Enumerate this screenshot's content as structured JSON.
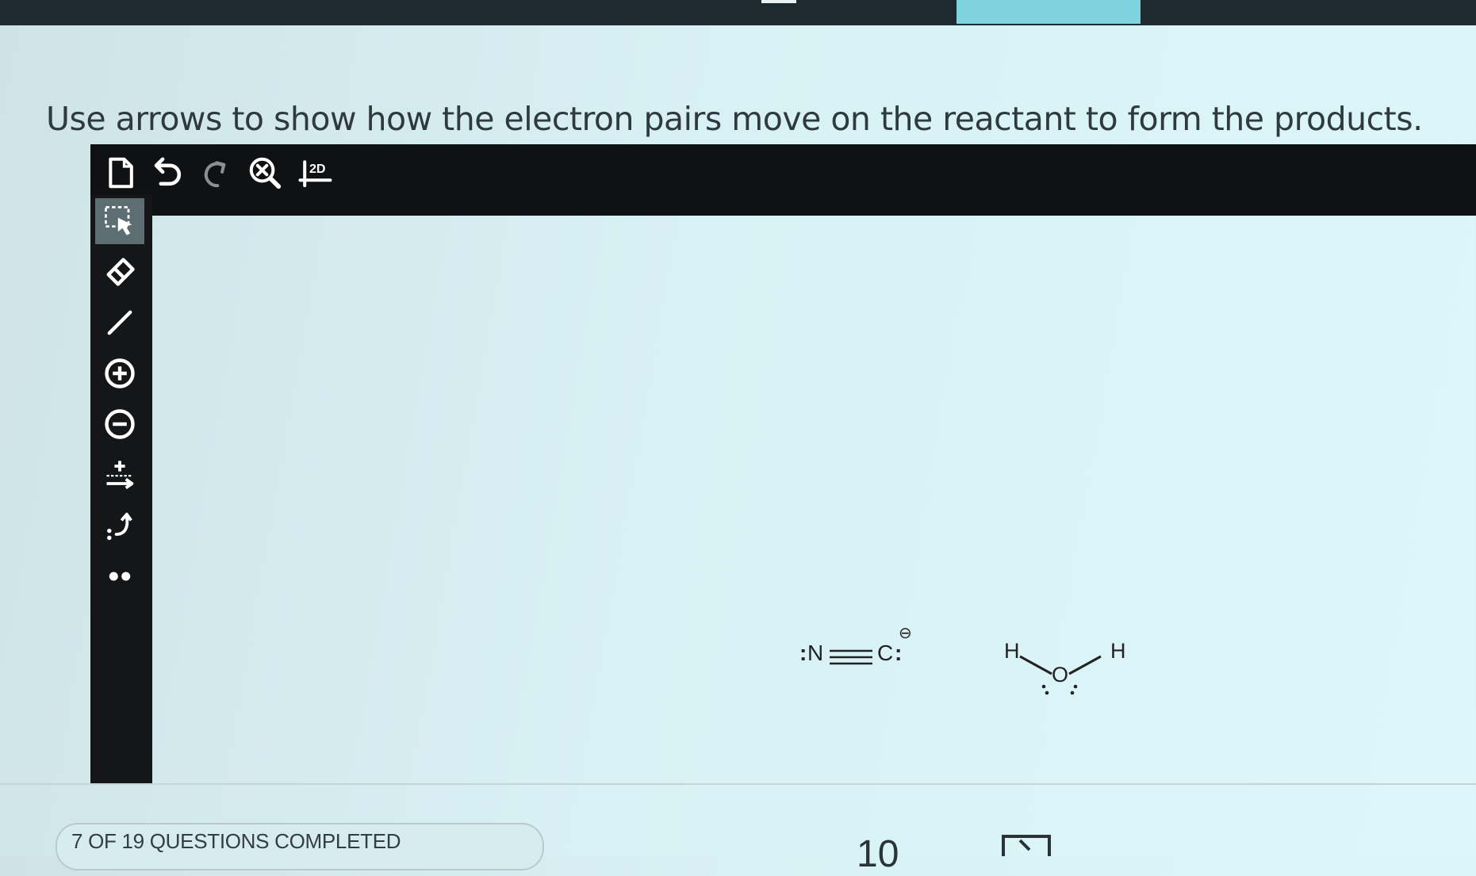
{
  "instruction": "Use arrows to show how the electron pairs move on the reactant to form the products.",
  "toolbar": {
    "items": [
      {
        "name": "new-document"
      },
      {
        "name": "undo"
      },
      {
        "name": "redo"
      },
      {
        "name": "clear-zoom"
      },
      {
        "name": "2d-view",
        "label": "2D"
      }
    ]
  },
  "sidebar": {
    "items": [
      {
        "name": "select",
        "active": true
      },
      {
        "name": "eraser"
      },
      {
        "name": "bond"
      },
      {
        "name": "positive-charge",
        "symbol": "+"
      },
      {
        "name": "negative-charge",
        "symbol": "−"
      },
      {
        "name": "reaction-arrow",
        "symbol": "+"
      },
      {
        "name": "curved-arrow",
        "symbol": ":"
      },
      {
        "name": "lone-pair",
        "symbol": "••"
      }
    ]
  },
  "molecules": {
    "cyanide": {
      "n": "N",
      "c": "C",
      "charge": "⊖",
      "lone_pair_left": ":",
      "lone_pair_right": ":"
    },
    "water": {
      "h_left": "H",
      "o": "O",
      "h_right": "H"
    }
  },
  "status": {
    "progress": "7 OF 19 QUESTIONS COMPLETED"
  },
  "bottom": {
    "partial_glyph": "10"
  },
  "colors": {
    "toolbar_bg": "#0f1112",
    "active_tool": "#5d6e73",
    "accent_tab": "#7fd3df"
  }
}
